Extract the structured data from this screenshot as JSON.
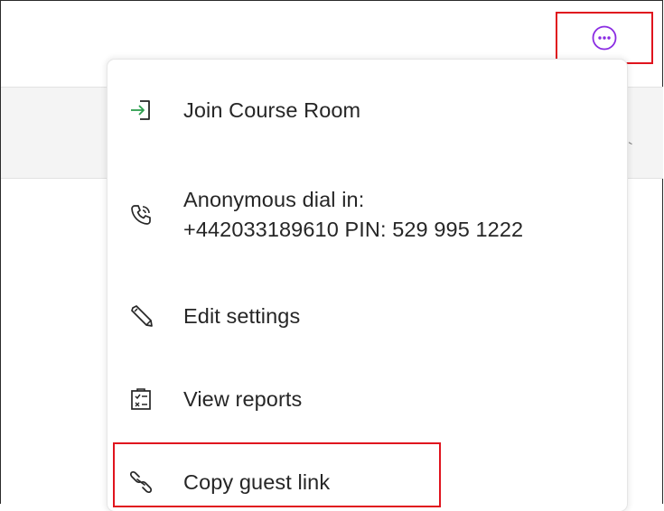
{
  "header": {
    "more_button_icon": "more-options-ellipsis-icon",
    "accent_color": "#8a2be2"
  },
  "menu": {
    "items": [
      {
        "id": "join",
        "label": "Join Course Room",
        "icon": "enter-room-icon"
      },
      {
        "id": "dial",
        "label_line1": "Anonymous dial in:",
        "label_line2": "+442033189610 PIN: 529 995 1222",
        "icon": "phone-icon"
      },
      {
        "id": "edit",
        "label": "Edit settings",
        "icon": "pencil-icon"
      },
      {
        "id": "view",
        "label": "View reports",
        "icon": "clipboard-report-icon"
      },
      {
        "id": "copy",
        "label": "Copy guest link",
        "icon": "link-icon"
      }
    ]
  },
  "highlight_color": "#e0141e"
}
